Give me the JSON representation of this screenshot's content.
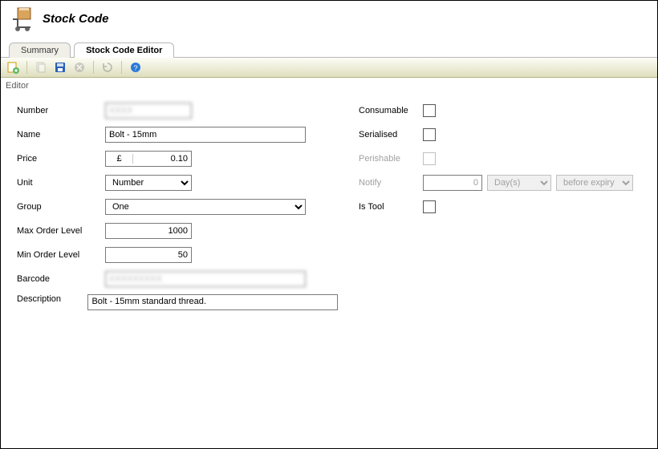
{
  "header": {
    "title": "Stock Code"
  },
  "tabs": {
    "summary": "Summary",
    "editor": "Stock Code Editor"
  },
  "groupLabel": "Editor",
  "left": {
    "numberLabel": "Number",
    "numberValue": "XXXX",
    "nameLabel": "Name",
    "nameValue": "Bolt - 15mm",
    "priceLabel": "Price",
    "currencySymbol": "£",
    "priceValue": "0.10",
    "unitLabel": "Unit",
    "unitValue": "Number",
    "groupLabel": "Group",
    "groupValue": "One",
    "maxLabel": "Max Order Level",
    "maxValue": "1000",
    "minLabel": "Min Order Level",
    "minValue": "50",
    "barcodeLabel": "Barcode",
    "barcodeValue": "XXXXXXXXX",
    "descLabel": "Description",
    "descValue": "Bolt - 15mm standard thread."
  },
  "right": {
    "consumableLabel": "Consumable",
    "serialisedLabel": "Serialised",
    "perishableLabel": "Perishable",
    "notifyLabel": "Notify",
    "notifyValue": "0",
    "notifyUnit": "Day(s)",
    "notifyWhen": "before expiry",
    "isToolLabel": "Is Tool"
  }
}
